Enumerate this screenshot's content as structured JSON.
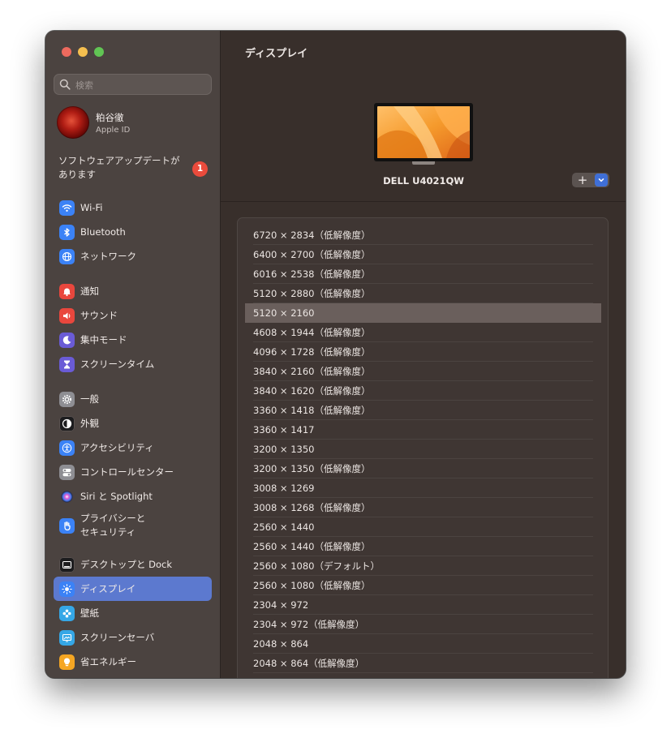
{
  "search": {
    "placeholder": "検索"
  },
  "account": {
    "name": "粕谷徹",
    "subtitle": "Apple ID"
  },
  "update": {
    "label": "ソフトウェアアップデートがあります",
    "badge": "1"
  },
  "sidebar": {
    "items": [
      {
        "label": "Wi-Fi",
        "icon": "wifi-icon",
        "color": "#3b82f6"
      },
      {
        "label": "Bluetooth",
        "icon": "bluetooth-icon",
        "color": "#3b82f6"
      },
      {
        "label": "ネットワーク",
        "icon": "globe-icon",
        "color": "#3b82f6"
      },
      {
        "label": "通知",
        "icon": "bell-icon",
        "color": "#e9473d"
      },
      {
        "label": "サウンド",
        "icon": "speaker-icon",
        "color": "#e9473d"
      },
      {
        "label": "集中モード",
        "icon": "moon-icon",
        "color": "#6a5bd6"
      },
      {
        "label": "スクリーンタイム",
        "icon": "hourglass-icon",
        "color": "#6a5bd6"
      },
      {
        "label": "一般",
        "icon": "gear-icon",
        "color": "#8e8e93"
      },
      {
        "label": "外観",
        "icon": "appearance-icon",
        "color": "#1c1c1e"
      },
      {
        "label": "アクセシビリティ",
        "icon": "accessibility-icon",
        "color": "#3b82f6"
      },
      {
        "label": "コントロールセンター",
        "icon": "toggles-icon",
        "color": "#8e8e93"
      },
      {
        "label": "Siri と Spotlight",
        "icon": "siri-icon",
        "color": "#8e4fd8"
      },
      {
        "label": "プライバシーと\nセキュリティ",
        "icon": "hand-icon",
        "color": "#3b82f6"
      },
      {
        "label": "デスクトップと Dock",
        "icon": "dock-icon",
        "color": "#1c1c1e"
      },
      {
        "label": "ディスプレイ",
        "icon": "sun-icon",
        "color": "#3b82f6"
      },
      {
        "label": "壁紙",
        "icon": "flower-icon",
        "color": "#35a7e6"
      },
      {
        "label": "スクリーンセーバ",
        "icon": "screensaver-icon",
        "color": "#35a7e6"
      },
      {
        "label": "省エネルギー",
        "icon": "bulb-icon",
        "color": "#f5a623"
      }
    ],
    "selected": "ディスプレイ"
  },
  "main": {
    "title": "ディスプレイ",
    "display_name": "DELL U4021QW",
    "add_button": "+",
    "resolutions": [
      "6720 × 2834（低解像度）",
      "6400 × 2700（低解像度）",
      "6016 × 2538（低解像度）",
      "5120 × 2880（低解像度）",
      "5120 × 2160",
      "4608 × 1944（低解像度）",
      "4096 × 1728（低解像度）",
      "3840 × 2160（低解像度）",
      "3840 × 1620（低解像度）",
      "3360 × 1418（低解像度）",
      "3360 × 1417",
      "3200 × 1350",
      "3200 × 1350（低解像度）",
      "3008 × 1269",
      "3008 × 1268（低解像度）",
      "2560 × 1440",
      "2560 × 1440（低解像度）",
      "2560 × 1080（デフォルト）",
      "2560 × 1080（低解像度）",
      "2304 × 972",
      "2304 × 972（低解像度）",
      "2048 × 864",
      "2048 × 864（低解像度）"
    ],
    "selected_resolution": "5120 × 2160"
  },
  "colors": {
    "accent": "#5c79cf",
    "close": "#ed6a5e",
    "minimize": "#f5bf4f",
    "zoom": "#61c554",
    "badge": "#ea4b3c"
  }
}
